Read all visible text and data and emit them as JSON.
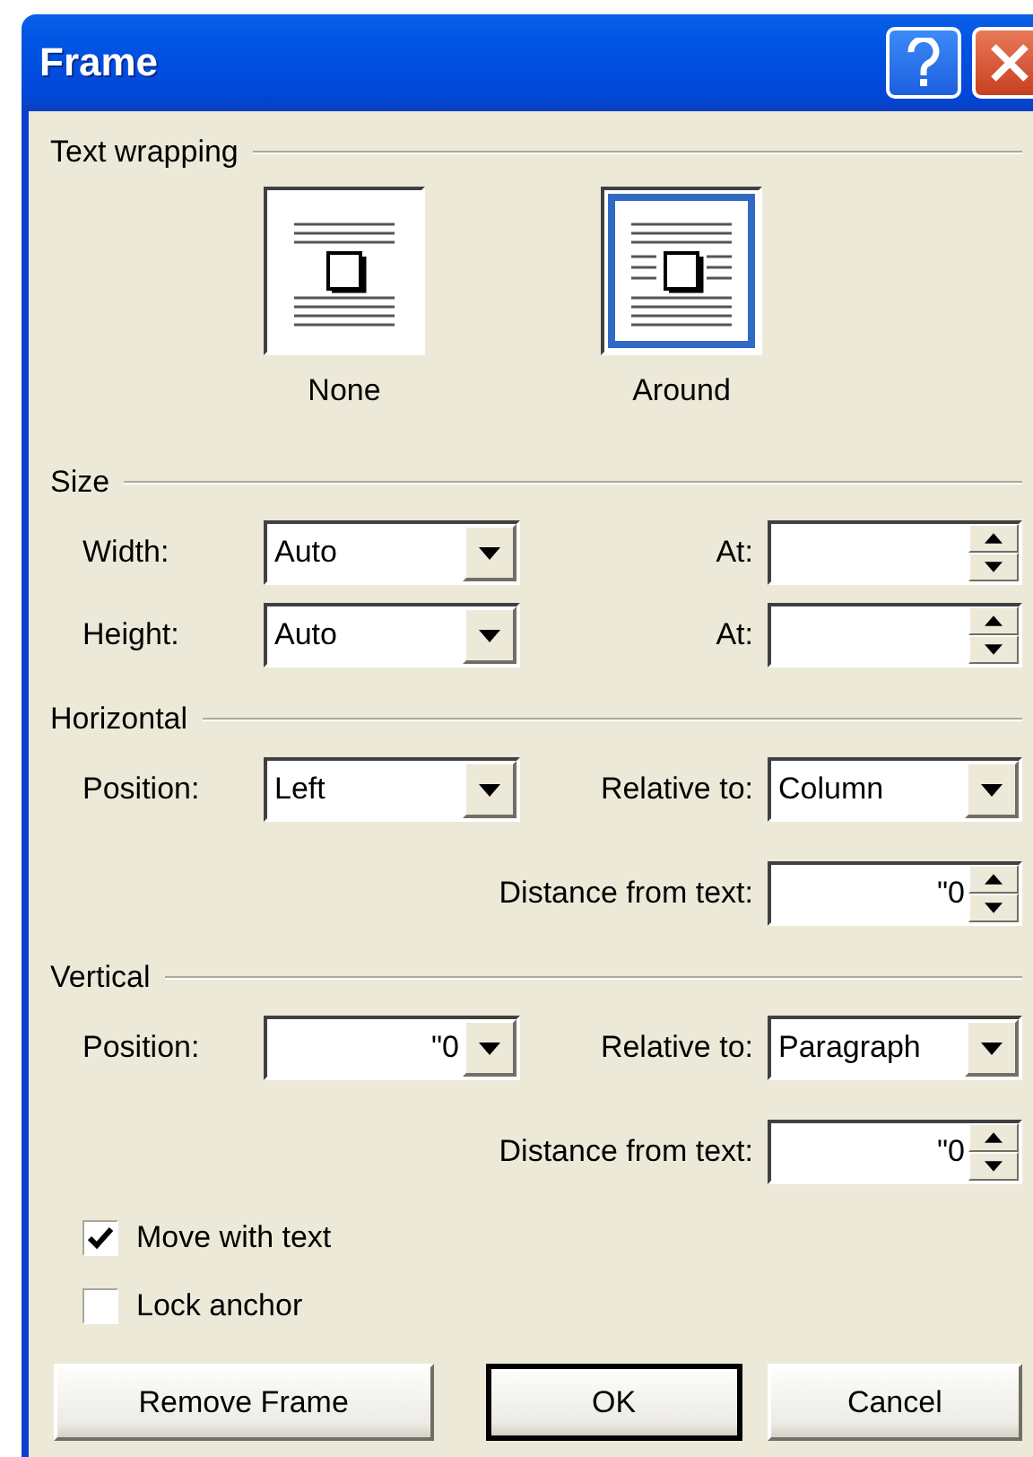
{
  "window": {
    "title": "Frame"
  },
  "text_wrapping": {
    "heading": "Text wrapping",
    "options": [
      {
        "label": "None",
        "kind": "none",
        "selected": false
      },
      {
        "label": "Around",
        "kind": "around",
        "selected": true
      }
    ]
  },
  "sections": [
    {
      "heading": "Size",
      "rows": [
        {
          "label": "Width:",
          "field": {
            "kind": "combo",
            "value": "Auto"
          },
          "right_label": "At:",
          "right_field": {
            "kind": "spin"
          }
        },
        {
          "label": "Height:",
          "field": {
            "kind": "combo",
            "value": "Auto"
          },
          "right_label": "At:",
          "right_field": {
            "kind": "spin"
          }
        }
      ]
    },
    {
      "heading": "Horizontal",
      "rows": [
        {
          "label": "Position:",
          "field": {
            "kind": "combo",
            "value": "Left"
          },
          "right_label": "Relative to:",
          "right_field": {
            "kind": "combo",
            "value": "Column"
          }
        },
        {
          "right_label": "Distance from text:",
          "right_field": {
            "kind": "spin",
            "value": "\"0"
          }
        }
      ]
    },
    {
      "heading": "Vertical",
      "rows": [
        {
          "label": "Position:",
          "field": {
            "kind": "number_combo",
            "value": "\"0"
          },
          "right_label": "Relative to:",
          "right_field": {
            "kind": "combo",
            "value": "Paragraph"
          }
        },
        {
          "right_label": "Distance from text:",
          "right_field": {
            "kind": "spin",
            "value": "\"0"
          }
        }
      ]
    }
  ],
  "checkboxes": [
    {
      "label": "Move with text",
      "checked": true
    },
    {
      "label": "Lock anchor",
      "checked": false
    }
  ],
  "buttons": [
    {
      "label": "Remove Frame",
      "default": false
    },
    {
      "label": "OK",
      "default": true
    },
    {
      "label": "Cancel",
      "default": false
    }
  ]
}
